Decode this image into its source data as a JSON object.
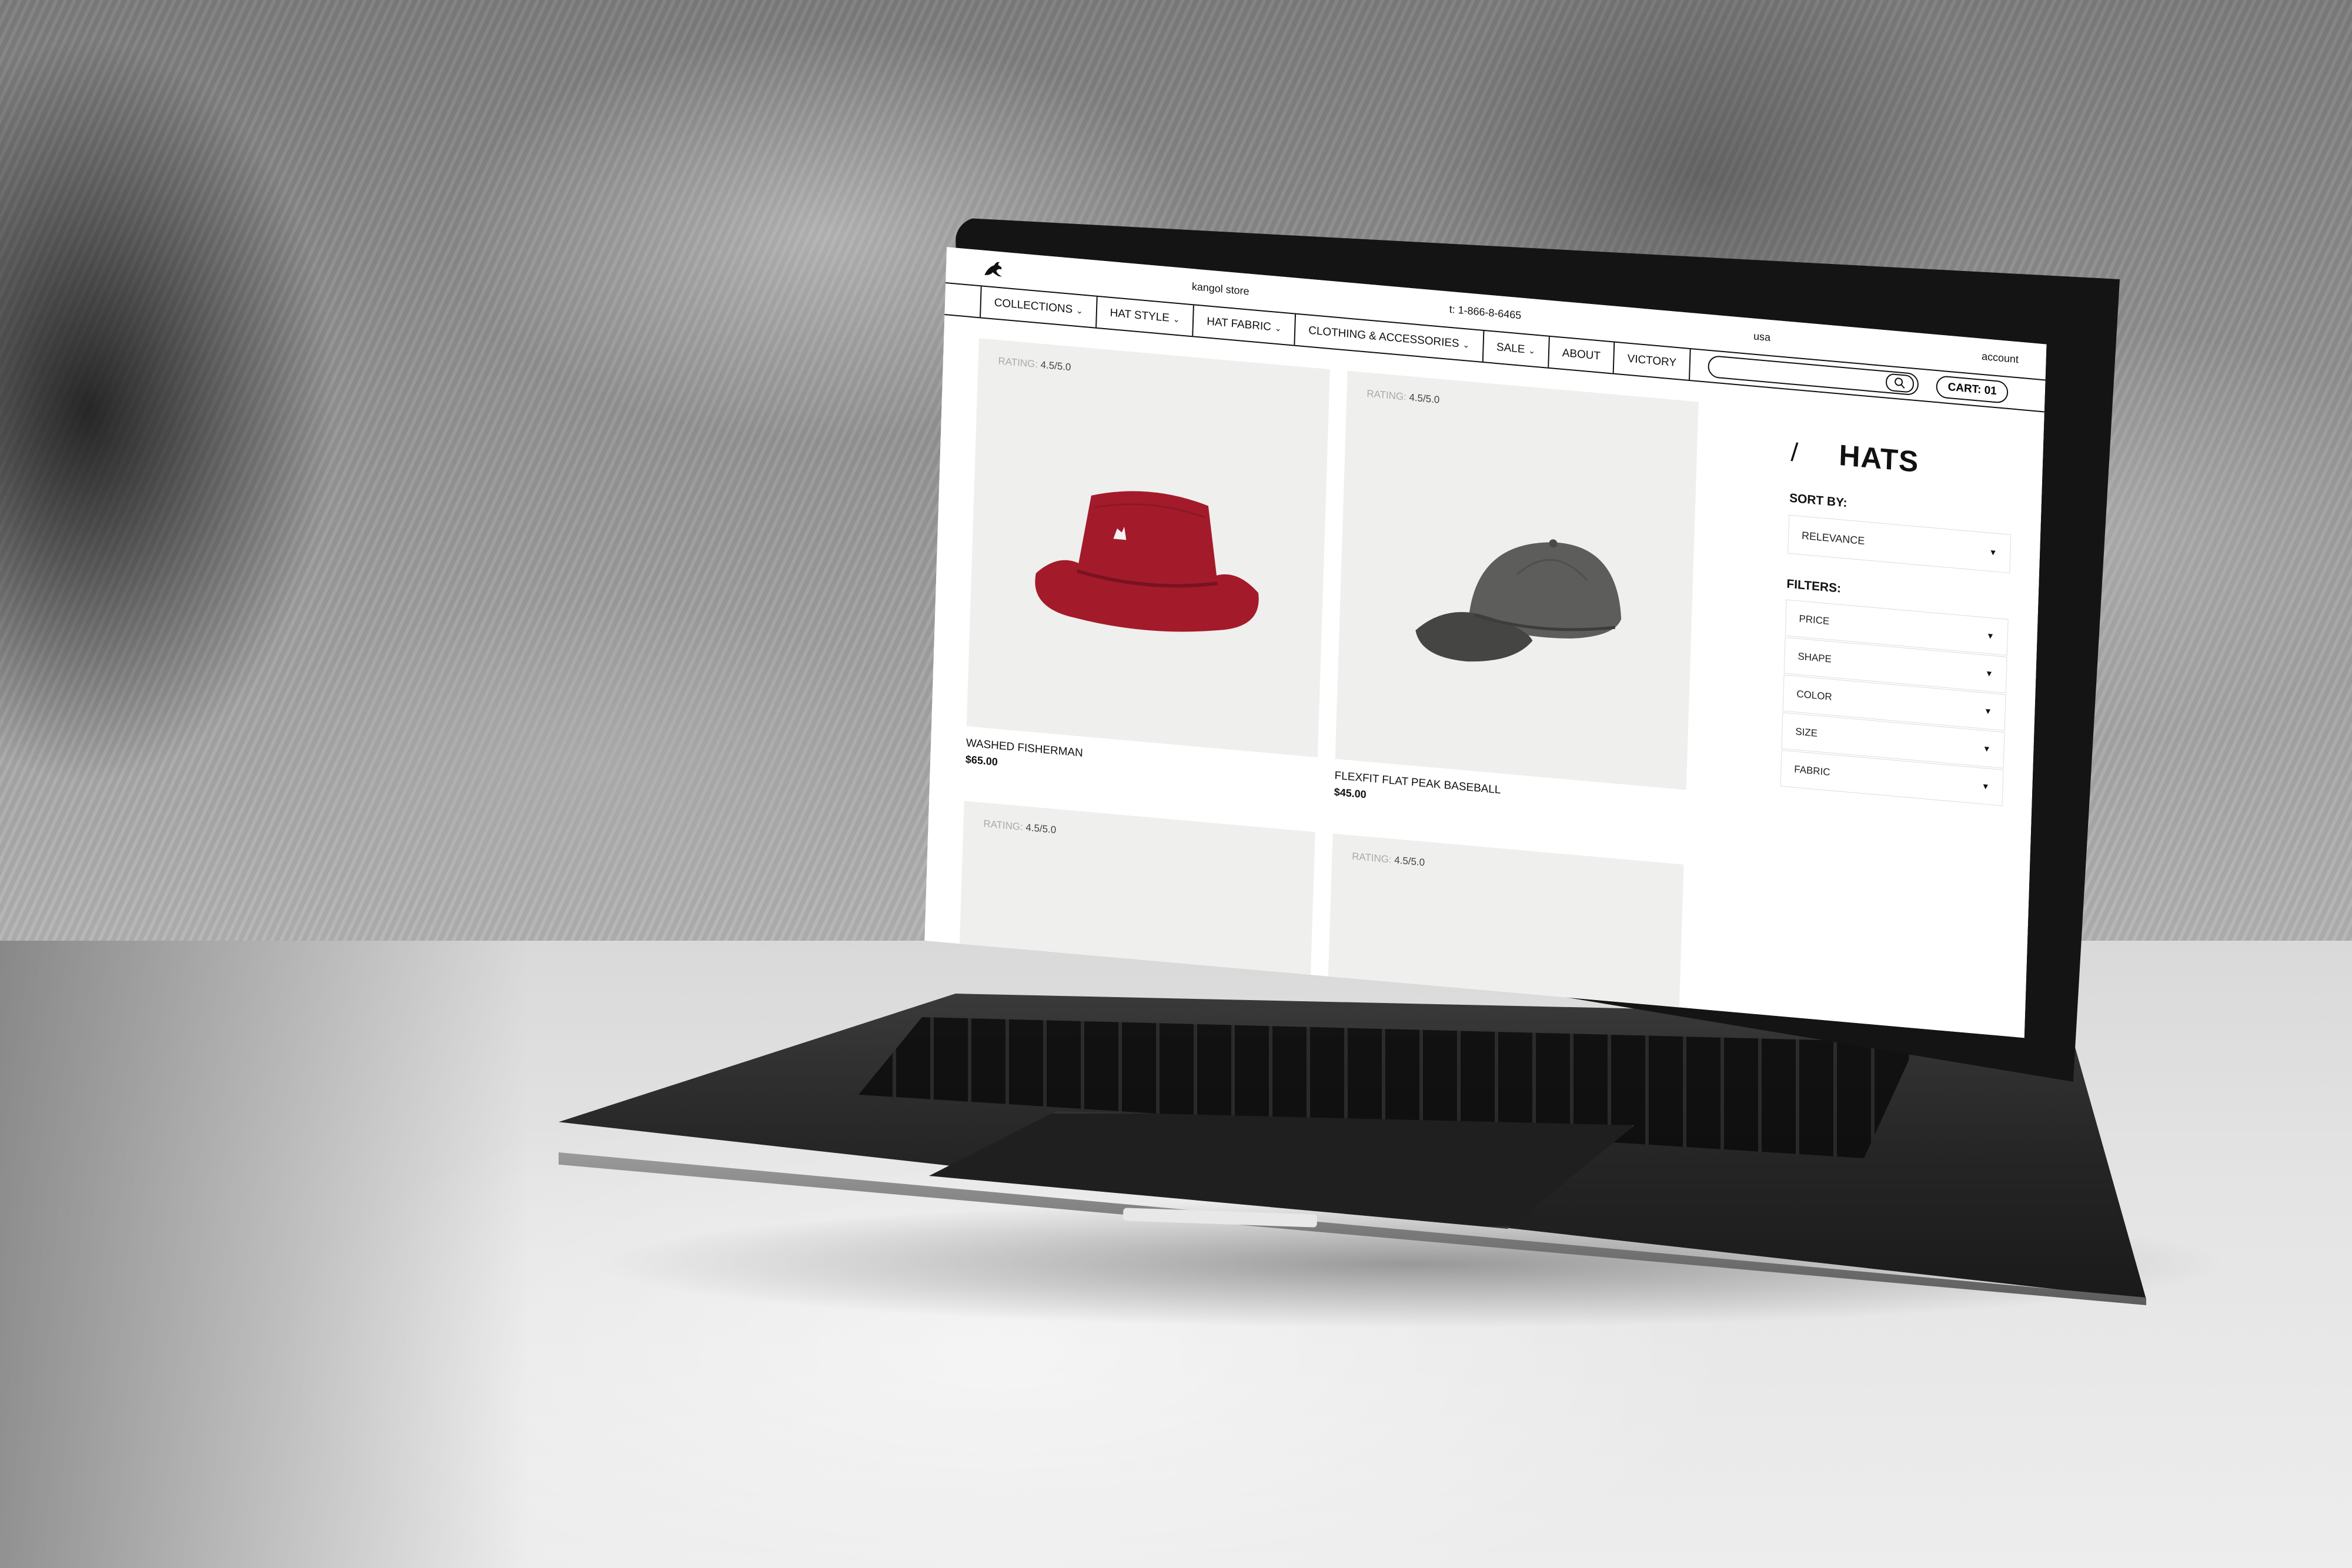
{
  "site": {
    "store_name": "kangol store",
    "phone": "t: 1-866-8-6465",
    "region": "usa",
    "account": "account"
  },
  "nav": {
    "items": [
      {
        "label": "COLLECTIONS",
        "has_dropdown": true
      },
      {
        "label": "HAT STYLE",
        "has_dropdown": true
      },
      {
        "label": "HAT FABRIC",
        "has_dropdown": true
      },
      {
        "label": "CLOTHING & ACCESSORIES",
        "has_dropdown": true
      },
      {
        "label": "SALE",
        "has_dropdown": true
      },
      {
        "label": "ABOUT",
        "has_dropdown": false
      },
      {
        "label": "VICTORY",
        "has_dropdown": false
      }
    ],
    "search_placeholder": "",
    "cart_label": "CART: 01"
  },
  "products": [
    {
      "rating_label": "RATING:",
      "rating": "4.5/5.0",
      "name": "WASHED FISHERMAN",
      "price": "$65.00",
      "hat_color": "#a31b2b",
      "hat_shape": "bucket"
    },
    {
      "rating_label": "RATING:",
      "rating": "4.5/5.0",
      "name": "FLEXFIT FLAT PEAK BASEBALL",
      "price": "$45.00",
      "hat_color": "#5d5d5b",
      "hat_shape": "cap"
    },
    {
      "rating_label": "RATING:",
      "rating": "4.5/5.0",
      "name": "",
      "price": "",
      "hat_color": "#4a76c9",
      "hat_shape": "cap-partial"
    },
    {
      "rating_label": "RATING:",
      "rating": "4.5/5.0",
      "name": "",
      "price": "",
      "hat_color": "#4a76c9",
      "hat_shape": "cap-partial"
    }
  ],
  "sidebar": {
    "breadcrumb_slash": "/",
    "title": "HATS",
    "sort_label": "SORT BY:",
    "sort_value": "RELEVANCE",
    "filters_label": "FILTERS:",
    "filters": [
      "PRICE",
      "SHAPE",
      "COLOR",
      "SIZE",
      "FABRIC"
    ]
  },
  "icons": {
    "logo": "kangaroo-logo-icon",
    "search": "search-icon",
    "dropdown": "chevron-down-icon",
    "caret": "caret-down-icon"
  }
}
